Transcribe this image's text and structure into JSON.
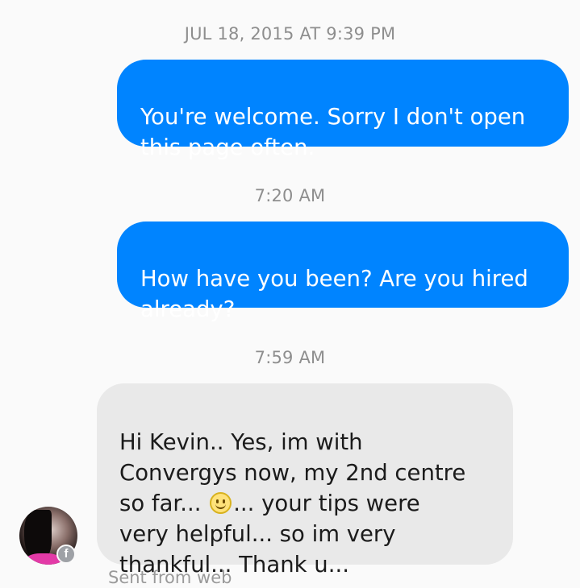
{
  "conversation": {
    "timestamps": [
      "JUL 18, 2015 AT 9:39 PM",
      "7:20 AM",
      "7:59 AM"
    ],
    "messages": [
      {
        "direction": "outgoing",
        "text": "You're welcome. Sorry I don't open\nthis page often."
      },
      {
        "direction": "outgoing",
        "text": "How have you been? Are you hired\nalready?"
      },
      {
        "direction": "incoming",
        "text_before_emoji": "Hi Kevin.. Yes, im with\nConvergys now, my 2nd centre\nso far... ",
        "emoji": "slightly-smiling-face-icon",
        "text_after_emoji": "... your tips were\nvery helpful... so im very\nthankful... Thank u..."
      }
    ],
    "sender_avatar_badge": "f",
    "sent_via": "Sent from web"
  },
  "colors": {
    "outgoing_bubble": "#0084ff",
    "incoming_bubble": "#e9e9e9",
    "timestamp_text": "#8e8e8e",
    "background": "#fafafa"
  }
}
